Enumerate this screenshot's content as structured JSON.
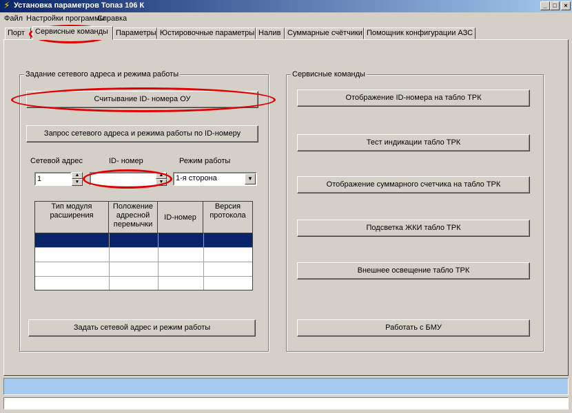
{
  "window": {
    "title": "Установка параметров Топаз 106 К",
    "minimize": "_",
    "maximize": "□",
    "close": "×"
  },
  "menu": [
    "Файл",
    "Настройки программы",
    "Справка"
  ],
  "tabs": [
    "Порт",
    "Сервисные команды",
    "Параметры",
    "Юстировочные параметры",
    "Налив",
    "Суммарные счётчики",
    "Помощник конфигурации АЗС"
  ],
  "active_tab": "Сервисные команды",
  "left_group": {
    "caption": "Задание сетевого адреса и режима работы",
    "read_id_button": "Считывание ID- номера ОУ",
    "request_button": "Запрос сетевого адреса и режима работы по ID-номеру",
    "net_address_label": "Сетевой адрес",
    "net_address_value": "1",
    "id_label": "ID- номер",
    "id_value": "",
    "mode_label": "Режим работы",
    "mode_value": "1-я сторона",
    "table_headers": [
      "Тип модуля расширения",
      "Положение адресной перемычки",
      "ID-номер",
      "Версия протокола"
    ],
    "set_button": "Задать сетевой адрес и режим работы"
  },
  "right_group": {
    "caption": "Сервисные команды",
    "buttons": [
      "Отображение ID-номера на табло ТРК",
      "Тест индикации табло ТРК",
      "Отображение суммарного счетчика на табло ТРК",
      "Подсветка ЖКИ табло ТРК",
      "Внешнее освещение табло ТРК",
      "Работать с БМУ"
    ]
  },
  "colors": {
    "titlebar": "#0a246a",
    "selection": "#0a246a",
    "status_bar": "#a6caf0",
    "annotation": "#e00000"
  }
}
